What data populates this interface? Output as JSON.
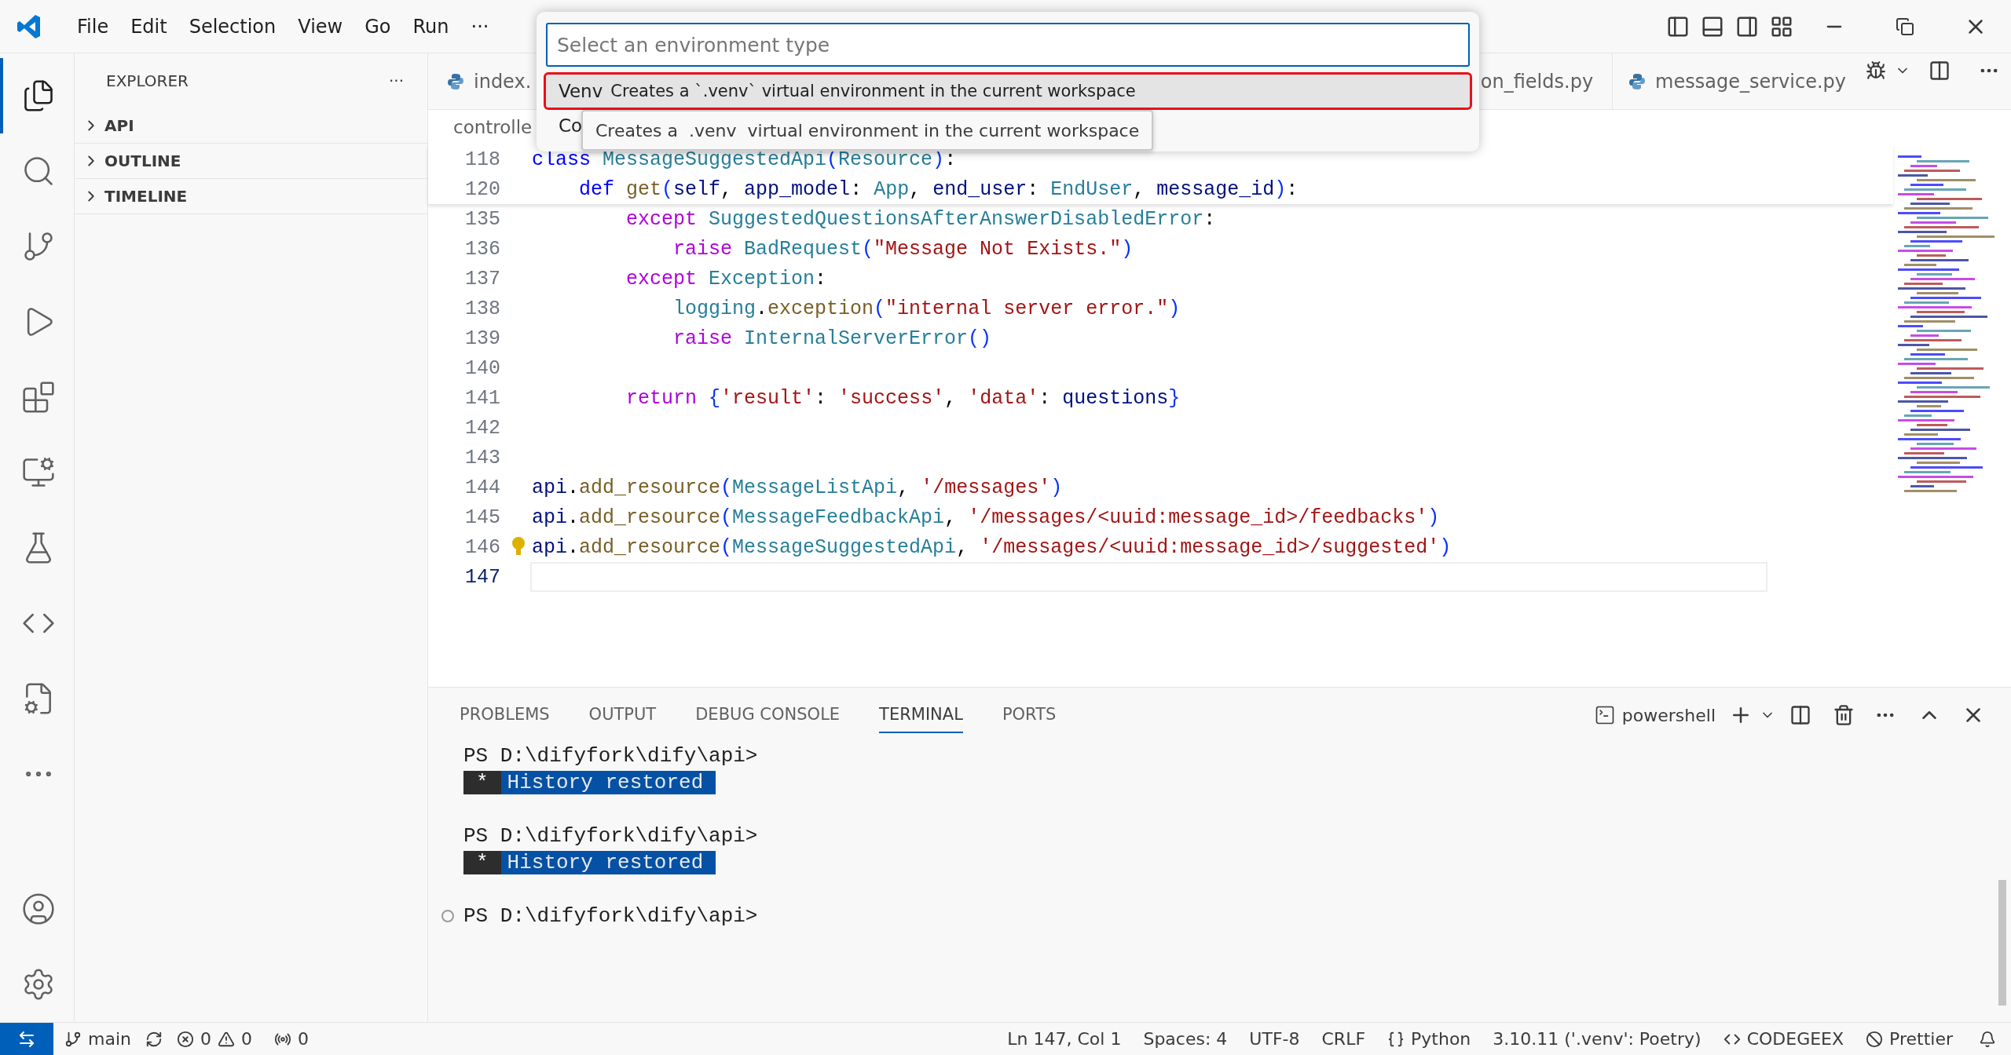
{
  "menu": [
    "File",
    "Edit",
    "Selection",
    "View",
    "Go",
    "Run",
    "···"
  ],
  "activity_bar": [
    {
      "selected": true
    },
    {
      "selected": false
    },
    {
      "selected": false
    },
    {
      "selected": false
    },
    {
      "selected": false
    },
    {
      "selected": false
    },
    {
      "selected": false
    },
    {
      "selected": false
    },
    {
      "selected": false
    },
    {
      "selected": false
    }
  ],
  "sidebar": {
    "title": "EXPLORER",
    "more": "···",
    "sections": [
      {
        "label": "API",
        "expanded": false
      },
      {
        "label": "OUTLINE",
        "expanded": false
      },
      {
        "label": "TIMELINE",
        "expanded": false
      }
    ]
  },
  "tabs": [
    {
      "label": "index.",
      "selected": false
    },
    {
      "label": "on_fields.py",
      "selected": false
    },
    {
      "label": "message_service.py",
      "selected": false
    }
  ],
  "breadcrumb": "controlle",
  "quick_pick": {
    "placeholder": "Select an environment type",
    "items": [
      {
        "label": "Venv",
        "description": "Creates a `.venv` virtual environment in the current workspace",
        "selected": true
      },
      {
        "label": "Co",
        "selected": false
      }
    ],
    "tooltip": "Creates a  .venv  virtual environment in the current workspace"
  },
  "sticky_lines": [
    {
      "number": "118",
      "tokens": [
        {
          "t": "class ",
          "kind": "kw"
        },
        {
          "t": "MessageSuggestedApi",
          "kind": "cls"
        },
        {
          "t": "(",
          "kind": "br"
        },
        {
          "t": "Resource",
          "kind": "cls"
        },
        {
          "t": ")",
          "kind": "br"
        },
        {
          "t": ":",
          "kind": "p"
        }
      ]
    },
    {
      "number": "120",
      "tokens": [
        {
          "t": "    def ",
          "kind": "kw"
        },
        {
          "t": "get",
          "kind": "fn"
        },
        {
          "t": "(",
          "kind": "br"
        },
        {
          "t": "self",
          "kind": "var"
        },
        {
          "t": ", ",
          "kind": "p"
        },
        {
          "t": "app_model",
          "kind": "var"
        },
        {
          "t": ": ",
          "kind": "p"
        },
        {
          "t": "App",
          "kind": "cls"
        },
        {
          "t": ", ",
          "kind": "p"
        },
        {
          "t": "end_user",
          "kind": "var"
        },
        {
          "t": ": ",
          "kind": "p"
        },
        {
          "t": "EndUser",
          "kind": "cls"
        },
        {
          "t": ", ",
          "kind": "p"
        },
        {
          "t": "message_id",
          "kind": "var"
        },
        {
          "t": ")",
          "kind": "br"
        },
        {
          "t": ":",
          "kind": "p"
        }
      ]
    }
  ],
  "lines": [
    {
      "number": "135",
      "current": false,
      "tokens": [
        {
          "t": "        except ",
          "kind": "ctrl"
        },
        {
          "t": "SuggestedQuestionsAfterAnswerDisabledError",
          "kind": "cls"
        },
        {
          "t": ":",
          "kind": "p"
        }
      ]
    },
    {
      "number": "136",
      "current": false,
      "tokens": [
        {
          "t": "            raise ",
          "kind": "ctrl"
        },
        {
          "t": "BadRequest",
          "kind": "cls"
        },
        {
          "t": "(",
          "kind": "br"
        },
        {
          "t": "\"Message Not Exists.\"",
          "kind": "str"
        },
        {
          "t": ")",
          "kind": "br"
        }
      ]
    },
    {
      "number": "137",
      "current": false,
      "tokens": [
        {
          "t": "        except ",
          "kind": "ctrl"
        },
        {
          "t": "Exception",
          "kind": "cls"
        },
        {
          "t": ":",
          "kind": "p"
        }
      ]
    },
    {
      "number": "138",
      "current": false,
      "tokens": [
        {
          "t": "            logging",
          "kind": "cls"
        },
        {
          "t": ".",
          "kind": "p"
        },
        {
          "t": "exception",
          "kind": "fn"
        },
        {
          "t": "(",
          "kind": "br"
        },
        {
          "t": "\"internal server error.\"",
          "kind": "str"
        },
        {
          "t": ")",
          "kind": "br"
        }
      ]
    },
    {
      "number": "139",
      "current": false,
      "tokens": [
        {
          "t": "            raise ",
          "kind": "ctrl"
        },
        {
          "t": "InternalServerError",
          "kind": "cls"
        },
        {
          "t": "()",
          "kind": "br"
        }
      ]
    },
    {
      "number": "140",
      "current": false
    },
    {
      "number": "141",
      "current": false,
      "tokens": [
        {
          "t": "        return ",
          "kind": "ctrl"
        },
        {
          "t": "{",
          "kind": "br"
        },
        {
          "t": "'result'",
          "kind": "str"
        },
        {
          "t": ": ",
          "kind": "p"
        },
        {
          "t": "'success'",
          "kind": "str"
        },
        {
          "t": ", ",
          "kind": "p"
        },
        {
          "t": "'data'",
          "kind": "str"
        },
        {
          "t": ": ",
          "kind": "p"
        },
        {
          "t": "questions",
          "kind": "var"
        },
        {
          "t": "}",
          "kind": "br"
        }
      ]
    },
    {
      "number": "142",
      "current": false
    },
    {
      "number": "143",
      "current": false
    },
    {
      "number": "144",
      "current": false,
      "tokens": [
        {
          "t": "api",
          "kind": "var"
        },
        {
          "t": ".",
          "kind": "p"
        },
        {
          "t": "add_resource",
          "kind": "fn"
        },
        {
          "t": "(",
          "kind": "br"
        },
        {
          "t": "MessageListApi",
          "kind": "cls"
        },
        {
          "t": ", ",
          "kind": "p"
        },
        {
          "t": "'/messages'",
          "kind": "str"
        },
        {
          "t": ")",
          "kind": "br"
        }
      ]
    },
    {
      "number": "145",
      "current": false,
      "tokens": [
        {
          "t": "api",
          "kind": "var"
        },
        {
          "t": ".",
          "kind": "p"
        },
        {
          "t": "add_resource",
          "kind": "fn"
        },
        {
          "t": "(",
          "kind": "br"
        },
        {
          "t": "MessageFeedbackApi",
          "kind": "cls"
        },
        {
          "t": ", ",
          "kind": "p"
        },
        {
          "t": "'/messages/<uuid:message_id>/feedbacks'",
          "kind": "str"
        },
        {
          "t": ")",
          "kind": "br"
        }
      ]
    },
    {
      "number": "146",
      "current": false,
      "lightbulb": true,
      "tokens": [
        {
          "t": "api",
          "kind": "var"
        },
        {
          "t": ".",
          "kind": "p"
        },
        {
          "t": "add_resource",
          "kind": "fn"
        },
        {
          "t": "(",
          "kind": "br"
        },
        {
          "t": "MessageSuggestedApi",
          "kind": "cls"
        },
        {
          "t": ", ",
          "kind": "p"
        },
        {
          "t": "'/messages/<uuid:message_id>/suggested'",
          "kind": "str"
        },
        {
          "t": ")",
          "kind": "br"
        }
      ]
    },
    {
      "number": "147",
      "current": true
    }
  ],
  "panel": {
    "tabs": [
      {
        "label": "PROBLEMS",
        "selected": false
      },
      {
        "label": "OUTPUT",
        "selected": false
      },
      {
        "label": "DEBUG CONSOLE",
        "selected": false
      },
      {
        "label": "TERMINAL",
        "selected": true
      },
      {
        "label": "PORTS",
        "selected": false
      }
    ],
    "shell": "powershell"
  },
  "terminal": [
    {
      "kind": "prompt",
      "text": "PS D:\\difyfork\\dify\\api>"
    },
    {
      "kind": "badge",
      "mark": "*",
      "text": "History restored"
    },
    {
      "kind": "blank"
    },
    {
      "kind": "prompt",
      "text": "PS D:\\difyfork\\dify\\api>"
    },
    {
      "kind": "badge",
      "mark": "*",
      "text": "History restored"
    },
    {
      "kind": "blank"
    },
    {
      "kind": "current",
      "text": "PS D:\\difyfork\\dify\\api>"
    }
  ],
  "status_bar": {
    "branch": "main",
    "errors": "0",
    "warnings": "0",
    "ports": "0",
    "right": [
      {
        "kind": "text",
        "text": "Ln 147, Col 1"
      },
      {
        "kind": "text",
        "text": "Spaces: 4"
      },
      {
        "kind": "text",
        "text": "UTF-8"
      },
      {
        "kind": "text",
        "text": "CRLF"
      },
      {
        "kind": "language",
        "text": "Python"
      },
      {
        "kind": "text",
        "text": "3.10.11 ('.venv': Poetry)"
      },
      {
        "kind": "codegeex",
        "text": "CODEGEEX"
      },
      {
        "kind": "prettier",
        "text": "Prettier"
      },
      {
        "kind": "bell"
      }
    ]
  }
}
